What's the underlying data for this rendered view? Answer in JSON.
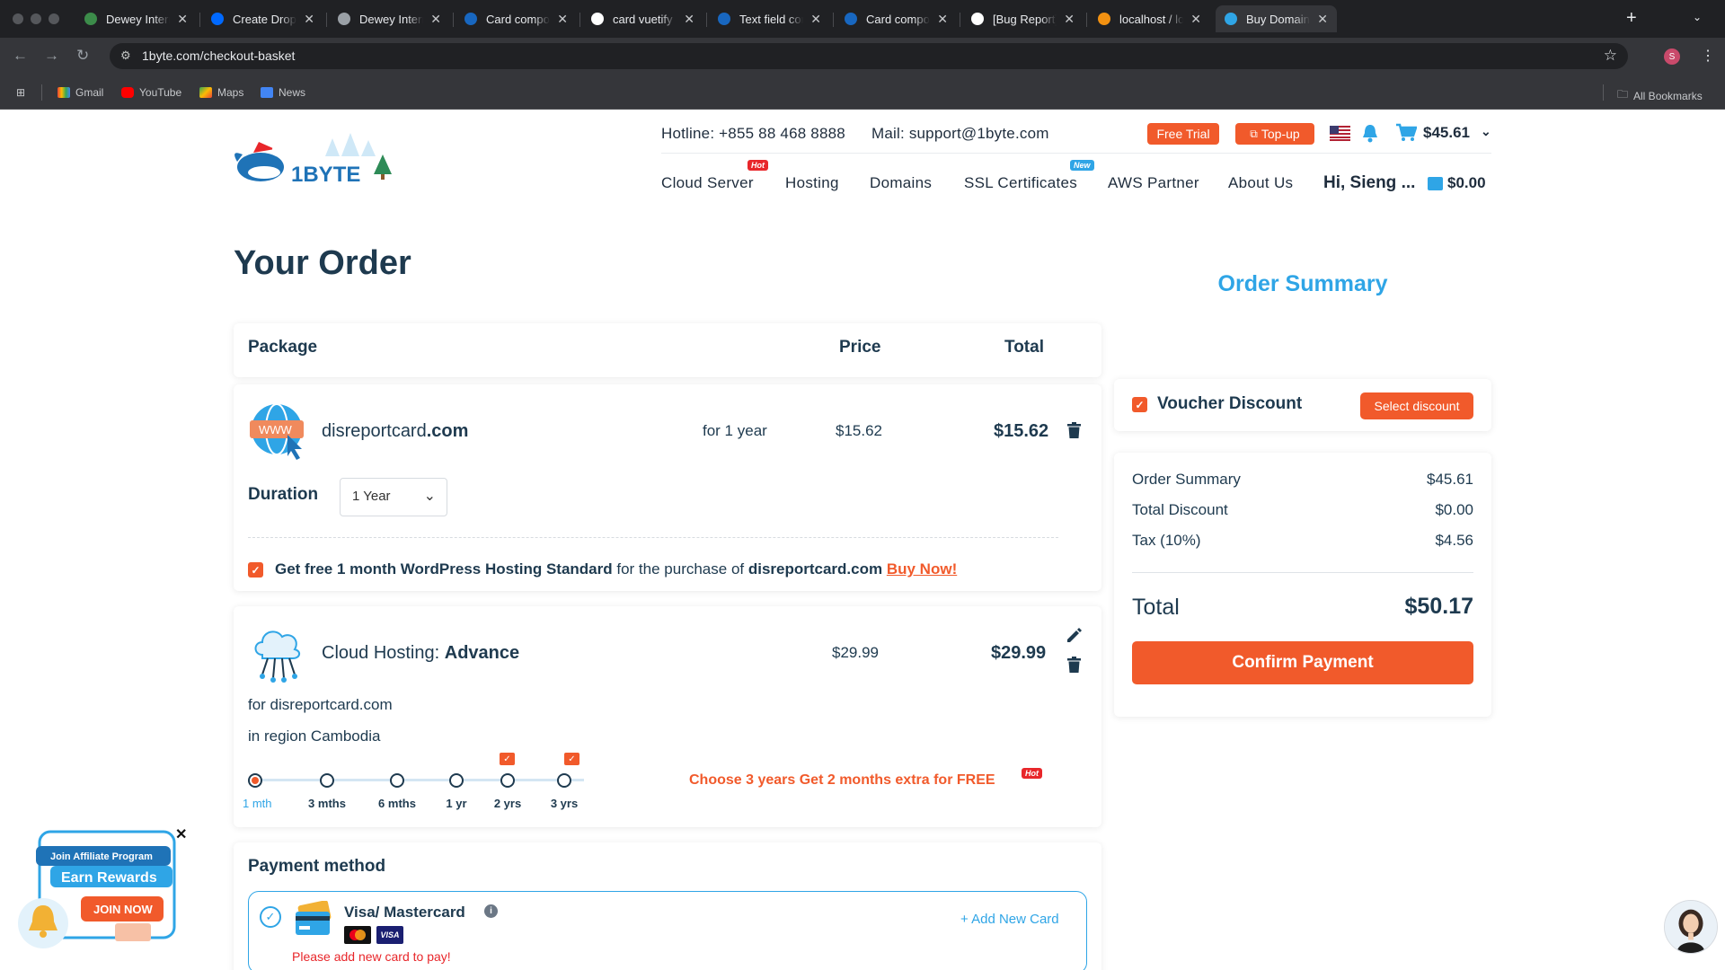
{
  "browser": {
    "tabs": [
      {
        "title": "Dewey International",
        "color": "#3c8c4a"
      },
      {
        "title": "Create Droplets -",
        "color": "#0069ff"
      },
      {
        "title": "Dewey International",
        "color": "#9aa0a6"
      },
      {
        "title": "Card component -",
        "color": "#1867c0"
      },
      {
        "title": "card vuetify - Google",
        "color": "#ffffff"
      },
      {
        "title": "Text field component",
        "color": "#1867c0"
      },
      {
        "title": "Card component -",
        "color": "#1867c0"
      },
      {
        "title": "[Bug Report] Card",
        "color": "#ffffff"
      },
      {
        "title": "localhost / localhost",
        "color": "#f29111"
      },
      {
        "title": "Buy Domain and Web",
        "color": "#2fa5e6"
      }
    ],
    "url": "1byte.com/checkout-basket",
    "profile_initial": "S",
    "bookmarks": [
      "Gmail",
      "YouTube",
      "Maps",
      "News"
    ],
    "all_bookmarks": "All Bookmarks"
  },
  "header": {
    "hotline": "Hotline: +855 88 468 8888",
    "mail": "Mail: support@1byte.com",
    "free_trial": "Free Trial",
    "topup": "Top-up",
    "cart_amount": "$45.61",
    "nav": [
      {
        "label": "Cloud Server",
        "badge": "Hot"
      },
      {
        "label": "Hosting",
        "badge": ""
      },
      {
        "label": "Domains",
        "badge": ""
      },
      {
        "label": "SSL Certificates",
        "badge": "New"
      },
      {
        "label": "AWS Partner",
        "badge": ""
      },
      {
        "label": "About Us",
        "badge": ""
      }
    ],
    "greeting": "Hi, Sieng ...",
    "wallet_amount": "$0.00",
    "colors": {
      "accent": "#f15a2b",
      "brand_blue": "#2fa5e6",
      "hot_badge": "#e8262a",
      "new_badge": "#2fa5e6"
    }
  },
  "order": {
    "title": "Your Order",
    "columns": {
      "package": "Package",
      "price": "Price",
      "total": "Total"
    },
    "domain_item": {
      "name_prefix": "disreportcard",
      "name_tld": ".com",
      "period": "for 1 year",
      "price": "$15.62",
      "total": "$15.62",
      "duration_label": "Duration",
      "duration_value": "1 Year",
      "promo_bold": "Get free 1 month WordPress Hosting Standard",
      "promo_mid": " for the purchase of ",
      "promo_domain": "disreportcard.com",
      "promo_link": "Buy Now!"
    },
    "hosting_item": {
      "name_prefix": "Cloud Hosting: ",
      "name_plan": "Advance",
      "price": "$29.99",
      "total": "$29.99",
      "for_domain": "for disreportcard.com",
      "region": "in region Cambodia",
      "periods": [
        "1 mth",
        "3 mths",
        "6 mths",
        "1 yr",
        "2 yrs",
        "3 yrs"
      ],
      "selected_period": "1 mth",
      "promo": "Choose 3 years Get 2 months extra for FREE",
      "promo_badge": "Hot"
    },
    "payment": {
      "title": "Payment method",
      "method": "Visa/ Mastercard",
      "error": "Please add new card to pay!",
      "add_card": "+ Add New Card",
      "visa": "VISA"
    }
  },
  "summary": {
    "title": "Order Summary",
    "voucher_label": "Voucher Discount",
    "select_discount": "Select discount",
    "rows": [
      {
        "label": "Order Summary",
        "value": "$45.61"
      },
      {
        "label": "Total Discount",
        "value": "$0.00"
      },
      {
        "label": "Tax (10%)",
        "value": "$4.56"
      }
    ],
    "total_label": "Total",
    "total_value": "$50.17",
    "confirm": "Confirm Payment"
  },
  "affiliate": {
    "line1": "Join Affiliate Program",
    "line2": "Earn Rewards",
    "cta": "JOIN NOW"
  },
  "logo_text": "1BYTE"
}
